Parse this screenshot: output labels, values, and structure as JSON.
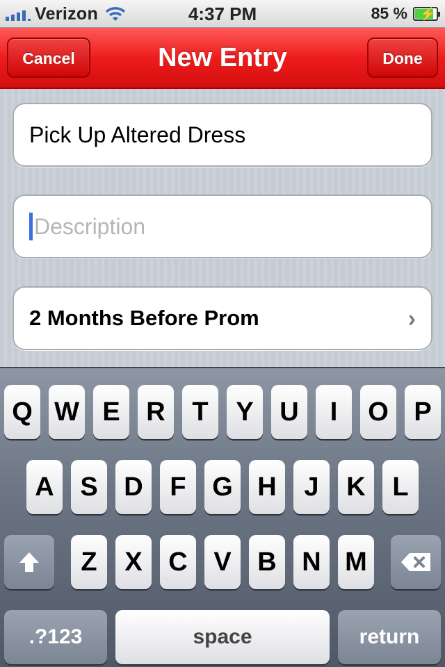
{
  "status_bar": {
    "carrier": "Verizon",
    "time": "4:37 PM",
    "battery_percent": "85 %",
    "battery_level": 0.85,
    "icons": [
      "signal-bars-icon",
      "wifi-icon",
      "battery-charging-icon"
    ]
  },
  "nav": {
    "title": "New Entry",
    "cancel_label": "Cancel",
    "done_label": "Done",
    "accent_color": "#ee1c1c"
  },
  "form": {
    "title_value": "Pick Up Altered Dress",
    "description_value": "",
    "description_placeholder": "Description",
    "date_value": "2 Months Before Prom",
    "date_chevron": "›"
  },
  "keyboard": {
    "row1": [
      "Q",
      "W",
      "E",
      "R",
      "T",
      "Y",
      "U",
      "I",
      "O",
      "P"
    ],
    "row2": [
      "A",
      "S",
      "D",
      "F",
      "G",
      "H",
      "J",
      "K",
      "L"
    ],
    "row3": [
      "Z",
      "X",
      "C",
      "V",
      "B",
      "N",
      "M"
    ],
    "numbers_label": ".?123",
    "space_label": "space",
    "return_label": "return",
    "shift_icon": "shift-arrow-icon",
    "delete_icon": "backspace-icon"
  }
}
